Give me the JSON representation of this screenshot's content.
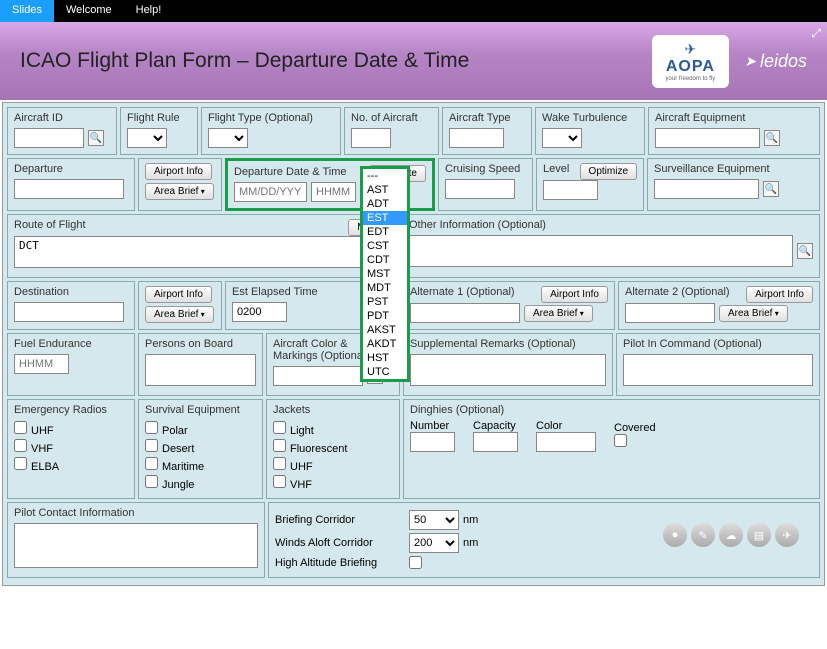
{
  "topbar": {
    "tabs": [
      "Slides",
      "Welcome",
      "Help!"
    ]
  },
  "header": {
    "title": "ICAO Flight Plan Form – Departure Date & Time",
    "aopa": {
      "name": "AOPA",
      "tagline": "your freedom to fly"
    },
    "leidos": "leidos"
  },
  "labels": {
    "aircraft_id": "Aircraft ID",
    "flight_rule": "Flight Rule",
    "flight_type": "Flight Type (Optional)",
    "no_aircraft": "No. of Aircraft",
    "aircraft_type": "Aircraft Type",
    "wake": "Wake Turbulence",
    "equipment": "Aircraft Equipment",
    "departure": "Departure",
    "dep_datetime": "Departure Date & Time",
    "cruising": "Cruising Speed",
    "level": "Level",
    "surveillance": "Surveillance Equipment",
    "route": "Route of Flight",
    "other_info": "Other Information (Optional)",
    "destination": "Destination",
    "est_elapsed": "Est Elapsed Time",
    "alt1": "Alternate 1 (Optional)",
    "alt2": "Alternate 2 (Optional)",
    "fuel": "Fuel Endurance",
    "persons": "Persons on Board",
    "color": "Aircraft Color & Markings (Optional)",
    "remarks": "Supplemental Remarks (Optional)",
    "pilot": "Pilot In Command (Optional)",
    "emerg_radios": "Emergency Radios",
    "survival": "Survival Equipment",
    "jackets": "Jackets",
    "dinghies": "Dinghies (Optional)",
    "pilot_contact": "Pilot Contact Information",
    "briefing_corridor": "Briefing Corridor",
    "winds_aloft": "Winds Aloft Corridor",
    "high_alt": "High Altitude Briefing",
    "number": "Number",
    "capacity": "Capacity",
    "color_lbl": "Color",
    "covered": "Covered",
    "nm": "nm"
  },
  "buttons": {
    "airport_info": "Airport Info",
    "area_brief": "Area Brief",
    "evaluate": "Evaluate",
    "optimize": "Optimize",
    "map": "Map"
  },
  "values": {
    "route": "DCT",
    "est_elapsed": "0200",
    "briefing_corridor": "50",
    "winds_aloft": "200"
  },
  "placeholders": {
    "date": "MM/DD/YYYY",
    "time": "HHMM",
    "hhmm": "HHMM"
  },
  "emergency_radios": [
    "UHF",
    "VHF",
    "ELBA"
  ],
  "survival_equipment": [
    "Polar",
    "Desert",
    "Maritime",
    "Jungle"
  ],
  "jackets": [
    "Light",
    "Fluorescent",
    "UHF",
    "VHF"
  ],
  "timezones": [
    "---",
    "AST",
    "ADT",
    "EST",
    "EDT",
    "CST",
    "CDT",
    "MST",
    "MDT",
    "PST",
    "PDT",
    "AKST",
    "AKDT",
    "HST",
    "UTC"
  ],
  "tz_selected": "EST"
}
